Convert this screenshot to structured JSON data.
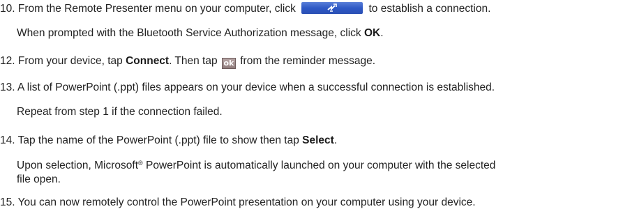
{
  "steps": [
    {
      "number": "10.",
      "before": "From the Remote Presenter menu on your computer, click",
      "after": "to establish a connection.",
      "icon": "connect-button-icon",
      "note": {
        "text": "When prompted with the Bluetooth Service Authorization message, click",
        "bold": "OK",
        "end": "."
      }
    },
    {
      "number": "12.",
      "before": "From your device, tap",
      "bold": "Connect",
      "middle": ". Then tap",
      "icon_label": "ok",
      "after": "from the reminder message."
    },
    {
      "number": "13.",
      "text": "A list of PowerPoint (.ppt) files appears on your device when a successful connection is established.",
      "note": "Repeat from step 1 if the connection failed."
    },
    {
      "number": "14.",
      "before": "Tap the name of the PowerPoint (.ppt) file to show then tap",
      "bold": "Select",
      "end": ".",
      "note": {
        "line1_before": "Upon selection, Microsoft",
        "reg": "®",
        "line1_after": " PowerPoint is automatically launched on your computer with the selected",
        "line2": "file open."
      }
    },
    {
      "number": "15.",
      "text": "You can now remotely control the PowerPoint presentation on your computer using your device."
    }
  ],
  "colors": {
    "text": "#222222",
    "connect_button": "#2f59c6",
    "ok_button": "#8f7b7b"
  }
}
